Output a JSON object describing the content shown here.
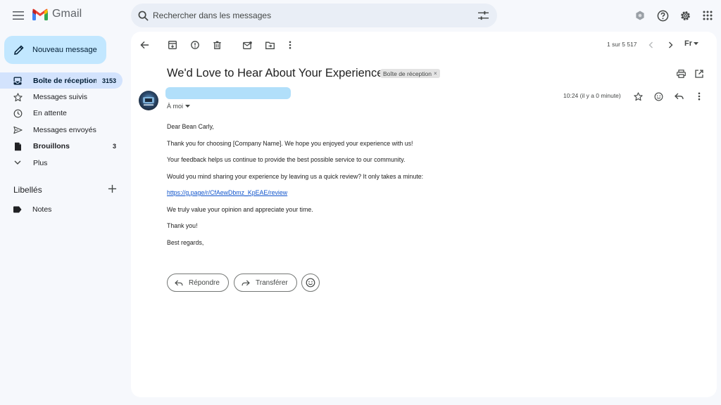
{
  "app": {
    "name": "Gmail"
  },
  "search": {
    "placeholder": "Rechercher dans les messages"
  },
  "compose": {
    "label": "Nouveau message"
  },
  "sidebar": {
    "items": [
      {
        "label": "Boîte de réception",
        "count": "3153",
        "icon": "inbox-icon"
      },
      {
        "label": "Messages suivis",
        "count": "",
        "icon": "star-icon"
      },
      {
        "label": "En attente",
        "count": "",
        "icon": "clock-icon"
      },
      {
        "label": "Messages envoyés",
        "count": "",
        "icon": "send-icon"
      },
      {
        "label": "Brouillons",
        "count": "3",
        "icon": "draft-icon"
      },
      {
        "label": "Plus",
        "count": "",
        "icon": "chevron-down-icon"
      }
    ],
    "labels_heading": "Libellés",
    "labels": [
      {
        "label": "Notes",
        "icon": "label-icon"
      }
    ]
  },
  "toolbar": {
    "pager": "1 sur 5 517",
    "language": "Fr"
  },
  "email": {
    "subject": "We'd Love to Hear About Your Experience",
    "label_chip": "Boîte de réception",
    "recipient": "À moi",
    "time": "10:24 (il y a 0 minute)",
    "body": {
      "greeting": "Dear Bean Carly,",
      "line1": "Thank you for choosing [Company Name]. We hope you enjoyed your experience with us!",
      "line2": "Your feedback helps us continue to provide the best possible service to our community.",
      "line3": "Would you mind sharing your experience by leaving us a quick review? It only takes a minute:",
      "link": "https://g.page/r/CfAewDbmz_KpEAE/review",
      "line4": "We truly value your opinion and appreciate your time.",
      "line5": "Thank you!",
      "signoff": "Best regards,"
    }
  },
  "actions": {
    "reply": "Répondre",
    "forward": "Transférer"
  },
  "colors": {
    "background": "#f6f8fc",
    "compose": "#c2e7ff",
    "active_nav": "#d3e3fd",
    "link": "#1155cc"
  }
}
